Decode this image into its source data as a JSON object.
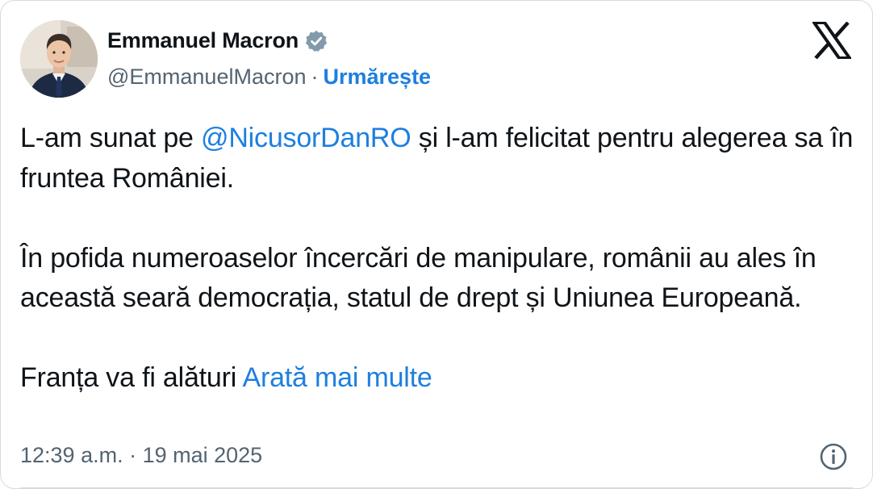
{
  "author": {
    "display_name": "Emmanuel Macron",
    "handle": "@EmmanuelMacron",
    "separator": "·",
    "follow_label": "Urmărește",
    "avatar_icon": "profile-photo",
    "verified_icon": "verified-badge-icon",
    "verified_color": "#829aab"
  },
  "brand": {
    "logo_icon": "x-logo-icon",
    "logo_color": "#0f1419"
  },
  "tweet": {
    "line1_prefix": "L-am sunat pe ",
    "mention": "@NicusorDanRO",
    "line1_suffix": " și l-am felicitat pentru alegerea sa în fruntea României.",
    "paragraph2": "În pofida numeroaselor încercări de manipulare, românii au ales în această seară democrația, statul de drept și Uniunea Europeană.",
    "paragraph3": "Franța va fi alături ",
    "show_more": "Arată mai multe",
    "link_color": "#1d7fe0",
    "text_color": "#0f1419"
  },
  "footer": {
    "timestamp": "12:39 a.m. · 19 mai 2025",
    "info_icon": "info-icon",
    "muted_color": "#536471"
  }
}
